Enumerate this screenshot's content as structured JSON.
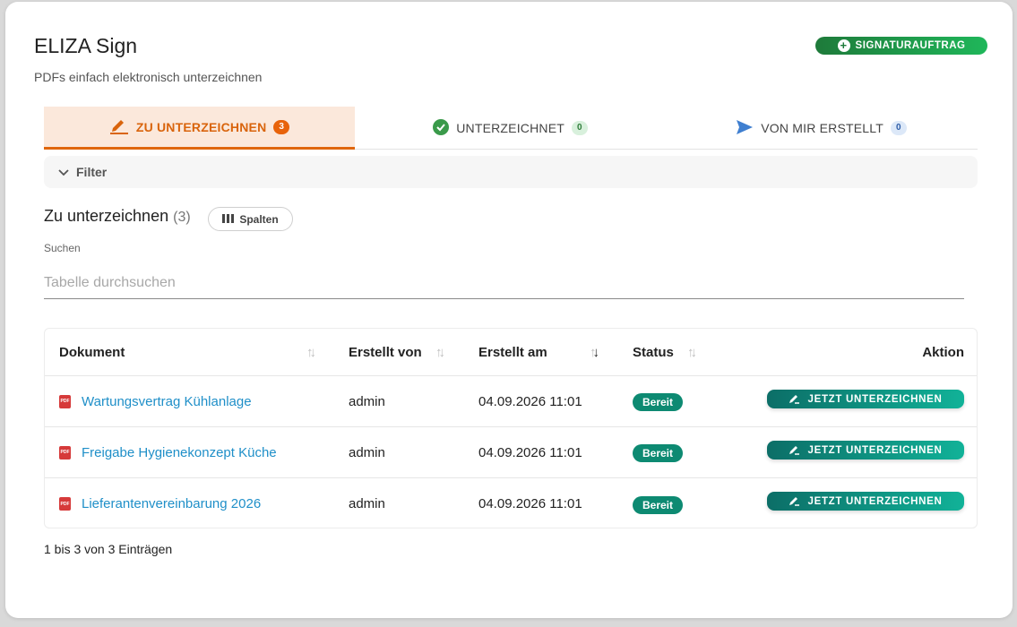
{
  "header": {
    "title": "ELIZA Sign",
    "subtitle": "PDFs einfach elektronisch unterzeichnen",
    "new_button_label": "SIGNATURAUFTRAG"
  },
  "tabs": [
    {
      "label": "ZU UNTERZEICHNEN",
      "count": "3",
      "icon": "pen-icon",
      "active": true
    },
    {
      "label": "UNTERZEICHNET",
      "count": "0",
      "icon": "check-circle-icon",
      "active": false
    },
    {
      "label": "VON MIR ERSTELLT",
      "count": "0",
      "icon": "send-icon",
      "active": false
    }
  ],
  "filter": {
    "label": "Filter"
  },
  "list": {
    "title": "Zu unterzeichnen",
    "count": "(3)",
    "columns_button": "Spalten"
  },
  "search": {
    "label": "Suchen",
    "placeholder": "Tabelle durchsuchen",
    "value": ""
  },
  "table": {
    "headers": {
      "document": "Dokument",
      "created_by": "Erstellt von",
      "created_at": "Erstellt am",
      "status": "Status",
      "action": "Aktion"
    },
    "rows": [
      {
        "document": "Wartungsvertrag Kühlanlage",
        "created_by": "admin",
        "created_at": "04.09.2026 11:01",
        "status": "Bereit",
        "action": "JETZT UNTERZEICHNEN"
      },
      {
        "document": "Freigabe Hygienekonzept Küche",
        "created_by": "admin",
        "created_at": "04.09.2026 11:01",
        "status": "Bereit",
        "action": "JETZT UNTERZEICHNEN"
      },
      {
        "document": "Lieferantenvereinbarung 2026",
        "created_by": "admin",
        "created_at": "04.09.2026 11:01",
        "status": "Bereit",
        "action": "JETZT UNTERZEICHNEN"
      }
    ]
  },
  "footer": {
    "pagination_info": "1 bis 3 von 3 Einträgen"
  }
}
